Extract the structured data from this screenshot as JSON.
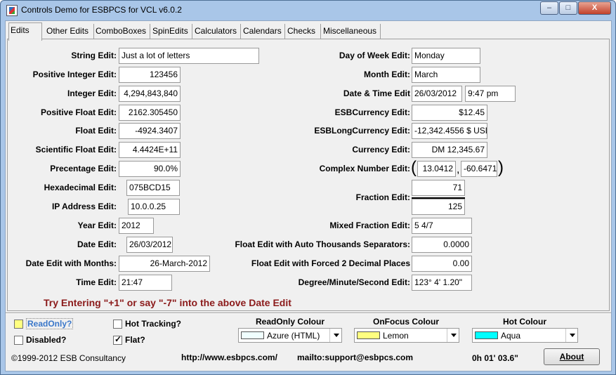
{
  "window": {
    "title": "Controls Demo for ESBPCS for VCL v6.0.2"
  },
  "tabs": [
    "Edits",
    "Other Edits",
    "ComboBoxes",
    "SpinEdits",
    "Calculators",
    "Calendars",
    "Checks",
    "Miscellaneous"
  ],
  "left_fields": [
    {
      "label": "String Edit:",
      "value": "Just a lot of letters"
    },
    {
      "label": "Positive Integer Edit:",
      "value": "123456"
    },
    {
      "label": "Integer Edit:",
      "value": "4,294,843,840"
    },
    {
      "label": "Positive Float Edit:",
      "value": "2162.305450"
    },
    {
      "label": "Float Edit:",
      "value": "-4924.3407"
    },
    {
      "label": "Scientific Float Edit:",
      "value": "4.4424E+11"
    },
    {
      "label": "Precentage Edit:",
      "value": "90.0%"
    },
    {
      "label": "Hexadecimal Edit:",
      "value": "075BCD15"
    },
    {
      "label": "IP Address Edit:",
      "value": "10.0.0.25"
    },
    {
      "label": "Year Edit:",
      "value": "2012"
    },
    {
      "label": "Date Edit:",
      "value": "26/03/2012"
    },
    {
      "label": "Date Edit with Months:",
      "value": "26-March-2012"
    },
    {
      "label": "Time Edit:",
      "value": "21:47"
    }
  ],
  "right_fields": {
    "day_of_week": {
      "label": "Day of Week Edit:",
      "value": "Monday"
    },
    "month": {
      "label": "Month Edit:",
      "value": "March"
    },
    "date_time": {
      "label": "Date & Time Edit",
      "date": "26/03/2012",
      "time": "9:47 pm"
    },
    "esb_currency": {
      "label": "ESBCurrency Edit:",
      "value": "$12.45"
    },
    "esb_long_currency": {
      "label": "ESBLongCurrency Edit:",
      "value": "-12,342.4556 $ USD"
    },
    "currency": {
      "label": "Currency Edit:",
      "value": "DM 12,345.67"
    },
    "complex": {
      "label": "Complex Number Edit:",
      "real": "13.0412",
      "imag": "-60.6471",
      "open": "(",
      "comma": ",",
      "close": ")"
    },
    "fraction": {
      "label": "Fraction Edit:",
      "numerator": "71",
      "denominator": "125"
    },
    "mixed_fraction": {
      "label": "Mixed Fraction Edit:",
      "value": "5 4/7"
    },
    "auto_thousands": {
      "label": "Float Edit with Auto Thousands Separators:",
      "value": "0.0000"
    },
    "forced_decimals": {
      "label": "Float Edit with Forced 2 Decimal Places",
      "value": "0.00"
    },
    "dms": {
      "label": "Degree/Minute/Second Edit:",
      "value": "123° 4' 1.20\""
    }
  },
  "hint": "Try Entering  \"+1\" or say \"-7\" into the above Date Edit",
  "options": {
    "readonly": {
      "label": "ReadOnly?",
      "checked": false
    },
    "disabled": {
      "label": "Disabled?",
      "checked": false
    },
    "hot_tracking": {
      "label": "Hot Tracking?",
      "checked": false
    },
    "flat": {
      "label": "Flat?",
      "checked": true
    }
  },
  "colours": {
    "readonly": {
      "heading": "ReadOnly Colour",
      "value": "Azure (HTML)",
      "swatch": "#f0ffff"
    },
    "onfocus": {
      "heading": "OnFocus Colour",
      "value": "Lemon",
      "swatch": "#ffff80"
    },
    "hot": {
      "heading": "Hot Colour",
      "value": "Aqua",
      "swatch": "#00ffff"
    }
  },
  "footer": {
    "copyright": "©1999-2012 ESB Consultancy",
    "url": "http://www.esbpcs.com/",
    "mail": "mailto:support@esbpcs.com",
    "timer": "0h 01' 03.6\"",
    "about_label": "About"
  },
  "window_buttons": {
    "minimize": "–",
    "maximize": "□",
    "close": "X"
  }
}
